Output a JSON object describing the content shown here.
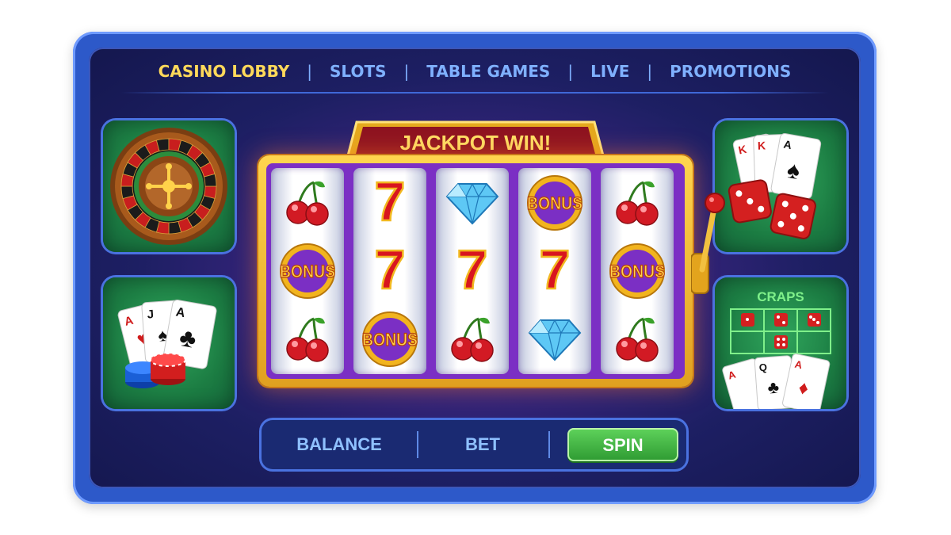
{
  "nav": {
    "items": [
      "CASINO LOBBY",
      "SLOTS",
      "TABLE GAMES",
      "LIVE",
      "PROMOTIONS"
    ],
    "active_index": 0,
    "separator": "|"
  },
  "slot_machine": {
    "banner": "JACKPOT WIN!",
    "reels": [
      [
        "cherry",
        "bonus",
        "cherry"
      ],
      [
        "seven",
        "seven",
        "bonus"
      ],
      [
        "diamond",
        "seven",
        "cherry"
      ],
      [
        "bonus",
        "seven",
        "diamond"
      ],
      [
        "cherry",
        "bonus",
        "cherry"
      ]
    ],
    "bonus_label": "BONUS"
  },
  "game_tiles": {
    "left": [
      {
        "name": "roulette",
        "icon": "roulette-wheel-icon"
      },
      {
        "name": "blackjack",
        "icon": "cards-and-chips-icon"
      }
    ],
    "right": [
      {
        "name": "poker-dice",
        "icon": "cards-and-dice-icon"
      },
      {
        "name": "craps",
        "icon": "craps-table-icon",
        "label": "CRAPS"
      }
    ],
    "card_ranks": {
      "left_bottom": [
        "A",
        "J",
        "A"
      ],
      "right_top": [
        "K",
        "K",
        "A"
      ],
      "right_bottom": [
        "A",
        "Q",
        "A"
      ]
    }
  },
  "controls": {
    "balance_label": "BALANCE",
    "bet_label": "BET",
    "spin_label": "SPIN"
  },
  "colors": {
    "accent_gold": "#ffd95a",
    "nav_blue": "#7fb0ff",
    "spin_green": "#3db23f",
    "frame_blue": "#2d59c9"
  }
}
